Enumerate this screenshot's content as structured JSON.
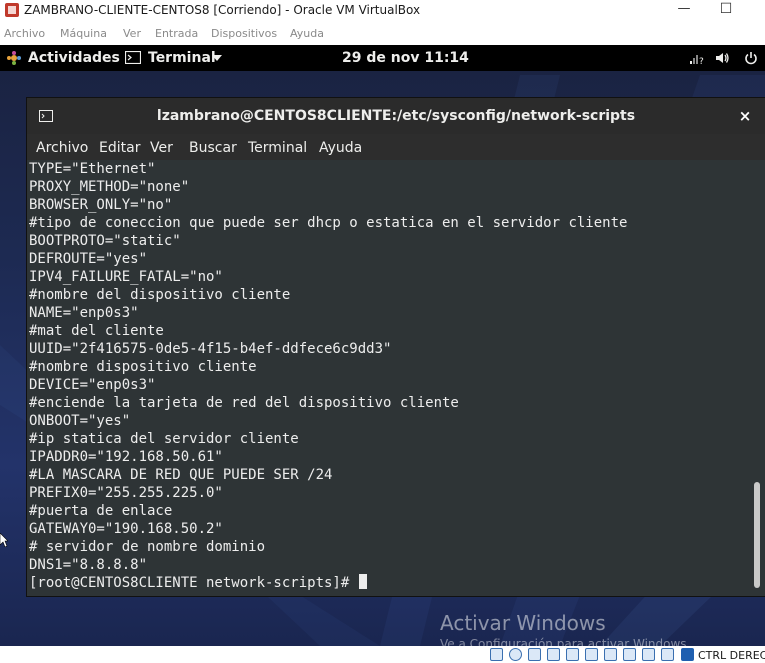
{
  "vbox": {
    "title": "ZAMBRANO-CLIENTE-CENTOS8 [Corriendo] - Oracle VM VirtualBox",
    "window_controls": {
      "minimize": "—",
      "maximize": "☐"
    },
    "menu": [
      "Archivo",
      "Máquina",
      "Ver",
      "Entrada",
      "Dispositivos",
      "Ayuda"
    ],
    "host_key": "CTRL DERECH"
  },
  "topbar": {
    "activities": "Actividades",
    "app": "Terminal",
    "clock": "29 de nov  11:14"
  },
  "terminal": {
    "title": "lzambrano@CENTOS8CLIENTE:/etc/sysconfig/network-scripts",
    "close": "×",
    "menu": [
      "Archivo",
      "Editar",
      "Ver",
      "Buscar",
      "Terminal",
      "Ayuda"
    ],
    "lines": [
      "TYPE=\"Ethernet\"",
      "PROXY_METHOD=\"none\"",
      "BROWSER_ONLY=\"no\"",
      "#tipo de coneccion que puede ser dhcp o estatica en el servidor cliente",
      "BOOTPROTO=\"static\"",
      "DEFROUTE=\"yes\"",
      "IPV4_FAILURE_FATAL=\"no\"",
      "#nombre del dispositivo cliente",
      "NAME=\"enp0s3\"",
      "#mat del cliente",
      "UUID=\"2f416575-0de5-4f15-b4ef-ddfece6c9dd3\"",
      "#nombre dispositivo cliente",
      "DEVICE=\"enp0s3\"",
      "#enciende la tarjeta de red del dispositivo cliente",
      "ONBOOT=\"yes\"",
      "#ip statica del servidor cliente",
      "IPADDR0=\"192.168.50.61\"",
      "#LA MASCARA DE RED QUE PUEDE SER /24",
      "PREFIX0=\"255.255.225.0\"",
      "#puerta de enlace",
      "GATEWAY0=\"190.168.50.2\"",
      "# servidor de nombre dominio",
      "DNS1=\"8.8.8.8\""
    ],
    "prompt": "[root@CENTOS8CLIENTE network-scripts]# "
  },
  "watermark": {
    "line1": "Activar Windows",
    "line2": "Ve a Configuración para activar Windows."
  },
  "colors": {
    "terminal_bg": "#2e3436",
    "terminal_fg": "#ededed",
    "topbar_bg": "#000000",
    "header_bg": "#2b2b2b"
  }
}
